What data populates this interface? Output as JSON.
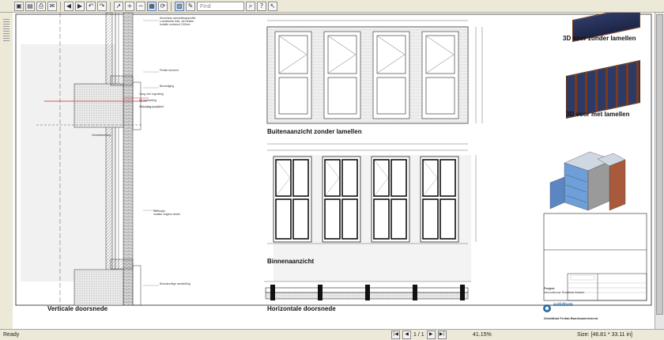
{
  "toolbar": {
    "find_placeholder": "Find",
    "icons": [
      "open-icon",
      "save-icon",
      "print-icon",
      "email-icon",
      "back-icon",
      "forward-icon",
      "undo-icon",
      "redo-icon",
      "select-icon",
      "zoom-in-icon",
      "zoom-out-icon",
      "fit-page-icon",
      "rotate-icon",
      "snapshot-icon",
      "markup-icon",
      "find-icon",
      "help-icon"
    ]
  },
  "drawing": {
    "labels": {
      "vertical_section": "Verticale doorsnede",
      "exterior_no_slats": "Buitenaanzicht zonder lamellen",
      "interior": "Binnenaanzicht",
      "horizontal_section": "Horizontale doorsnede",
      "view3d_no_slats": "3D voor zonder lamellen",
      "view3d_with_slats": "3D voor met lamellen"
    },
    "title_block": {
      "project_label": "Project",
      "project_name": "Inkoonbouw Stadhuis Almelo",
      "company": "solidium",
      "title": "Detailblad Prefab Bandraamelement"
    }
  },
  "status": {
    "ready": "Ready",
    "page": "1 / 1",
    "zoom": "41.15%",
    "size": "Size: [46.81 * 33.11 in]"
  },
  "colors": {
    "window_frame": "#7b3a1a",
    "glass": "#4a6fb0",
    "building_blue": "#6f9fd8",
    "red_line": "#d62020"
  }
}
